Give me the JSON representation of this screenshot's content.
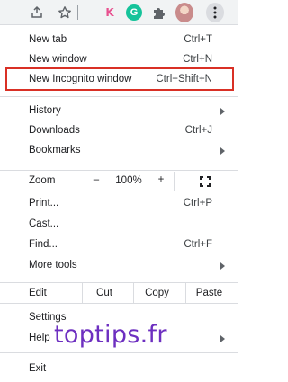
{
  "toolbar": {
    "icons": [
      "share-icon",
      "star-icon",
      "k-extension-icon",
      "grammarly-icon",
      "extensions-icon",
      "profile-avatar",
      "menu-kebab-icon"
    ],
    "k_letter": "K",
    "g_letter": "G"
  },
  "menu": {
    "new_tab": {
      "label": "New tab",
      "shortcut": "Ctrl+T"
    },
    "new_window": {
      "label": "New window",
      "shortcut": "Ctrl+N"
    },
    "new_incognito": {
      "label": "New Incognito window",
      "shortcut": "Ctrl+Shift+N"
    },
    "history": {
      "label": "History"
    },
    "downloads": {
      "label": "Downloads",
      "shortcut": "Ctrl+J"
    },
    "bookmarks": {
      "label": "Bookmarks"
    },
    "zoom": {
      "label": "Zoom",
      "minus": "–",
      "value": "100%",
      "plus": "+"
    },
    "print": {
      "label": "Print...",
      "shortcut": "Ctrl+P"
    },
    "cast": {
      "label": "Cast..."
    },
    "find": {
      "label": "Find...",
      "shortcut": "Ctrl+F"
    },
    "more_tools": {
      "label": "More tools"
    },
    "edit": {
      "label": "Edit",
      "cut": "Cut",
      "copy": "Copy",
      "paste": "Paste"
    },
    "settings": {
      "label": "Settings"
    },
    "help": {
      "label": "Help"
    },
    "exit": {
      "label": "Exit"
    }
  },
  "highlight_color": "#d93025",
  "watermark": {
    "text": "toptips.fr",
    "color": "#6d2fc0"
  }
}
